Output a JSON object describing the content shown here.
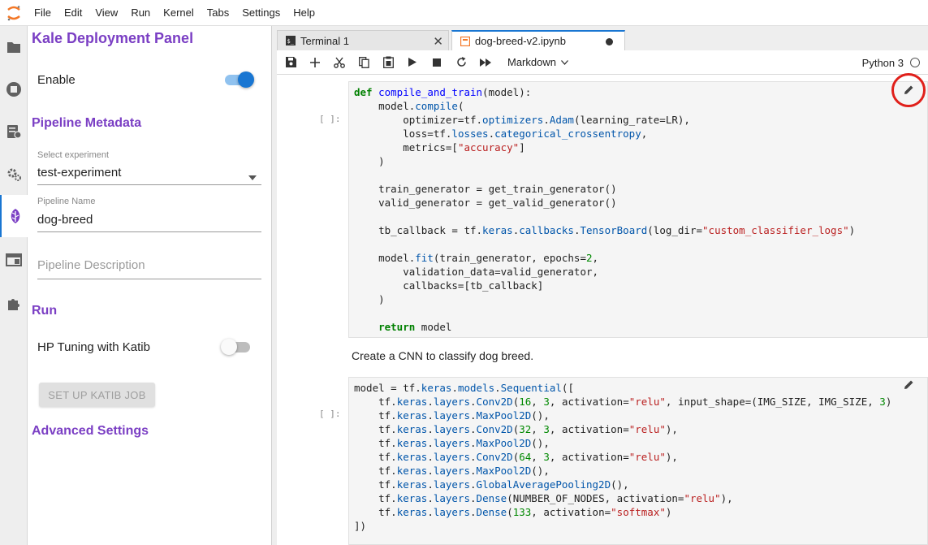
{
  "menubar": {
    "items": [
      "File",
      "Edit",
      "View",
      "Run",
      "Kernel",
      "Tabs",
      "Settings",
      "Help"
    ]
  },
  "left_strip": {
    "icons": [
      "folder-icon",
      "running-icon",
      "commands-icon",
      "property-inspector-icon",
      "kale-icon",
      "tabs-icon",
      "extensions-icon"
    ]
  },
  "kale": {
    "title": "Kale Deployment Panel",
    "enable_label": "Enable",
    "enable_on": true,
    "pipeline_metadata_title": "Pipeline Metadata",
    "experiment_caption": "Select experiment",
    "experiment_value": "test-experiment",
    "pipeline_name_caption": "Pipeline Name",
    "pipeline_name_value": "dog-breed",
    "pipeline_description_placeholder": "Pipeline Description",
    "run_title": "Run",
    "hp_tuning_label": "HP Tuning with Katib",
    "hp_tuning_on": false,
    "katib_button": "SET UP KATIB JOB",
    "advanced_title": "Advanced Settings",
    "accent_color": "#7b3fc4",
    "toggle_color": "#1976d2"
  },
  "tabs": [
    {
      "label": "Terminal 1",
      "active": false
    },
    {
      "label": "dog-breed-v2.ipynb",
      "active": true
    }
  ],
  "toolbar": {
    "cell_type": "Markdown",
    "kernel": "Python 3"
  },
  "cells": {
    "cell1_prompt": "[ ]:",
    "markdown_text": "Create a CNN to classify dog breed.",
    "cell2_prompt": "[ ]:"
  }
}
